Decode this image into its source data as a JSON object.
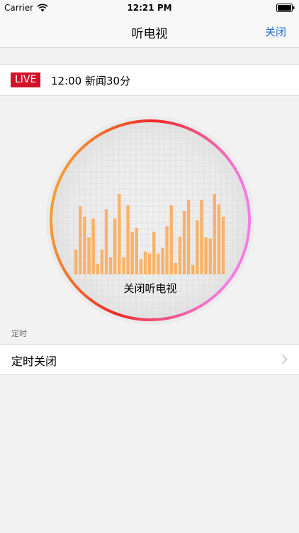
{
  "status_bar": {
    "carrier": "Carrier",
    "time": "12:21 PM"
  },
  "nav": {
    "title": "听电视",
    "close_label": "关闭"
  },
  "live": {
    "badge": "LIVE",
    "program": "12:00 新闻30分"
  },
  "player": {
    "action_label": "关闭听电视",
    "ring_colors": [
      "#f7b733",
      "#ee2a2a",
      "#f47ee4"
    ],
    "bar_color": "#f9b268",
    "levels": [
      0.26,
      0.72,
      0.61,
      0.39,
      0.59,
      0.11,
      0.26,
      0.69,
      0.18,
      0.59,
      0.85,
      0.18,
      0.73,
      0.45,
      0.49,
      0.16,
      0.24,
      0.22,
      0.45,
      0.22,
      0.28,
      0.51,
      0.73,
      0.12,
      0.4,
      0.67,
      0.79,
      0.1,
      0.57,
      0.79,
      0.39,
      0.38,
      0.85,
      0.74,
      0.61
    ]
  },
  "timer": {
    "section_header": "定时",
    "row_label": "定时关闭"
  },
  "colors": {
    "accent": "#1e6fd0",
    "live_red": "#d3122a"
  }
}
